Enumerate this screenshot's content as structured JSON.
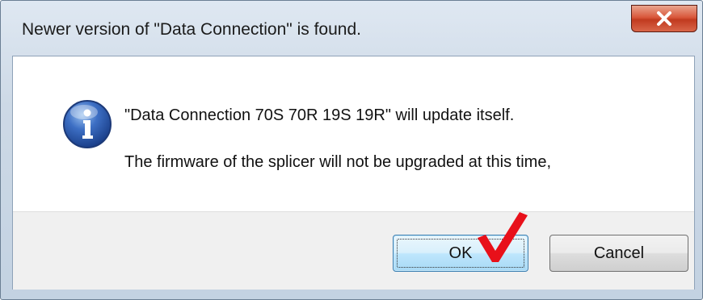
{
  "window": {
    "title": "Newer version of \"Data Connection\" is found.",
    "close_icon": "close-icon"
  },
  "message": {
    "icon": "info-icon",
    "line1": "\"Data Connection 70S 70R 19S 19R\" will update itself.",
    "line2": "The firmware of the splicer will not be upgraded at this time,"
  },
  "buttons": {
    "ok_label": "OK",
    "cancel_label": "Cancel"
  },
  "annotation": {
    "icon": "checkmark-icon",
    "color": "#e8101a"
  },
  "colors": {
    "close_button": "#c8452a",
    "default_button_border": "#3c7fb1",
    "dialog_frame": "#c3d2e2"
  }
}
